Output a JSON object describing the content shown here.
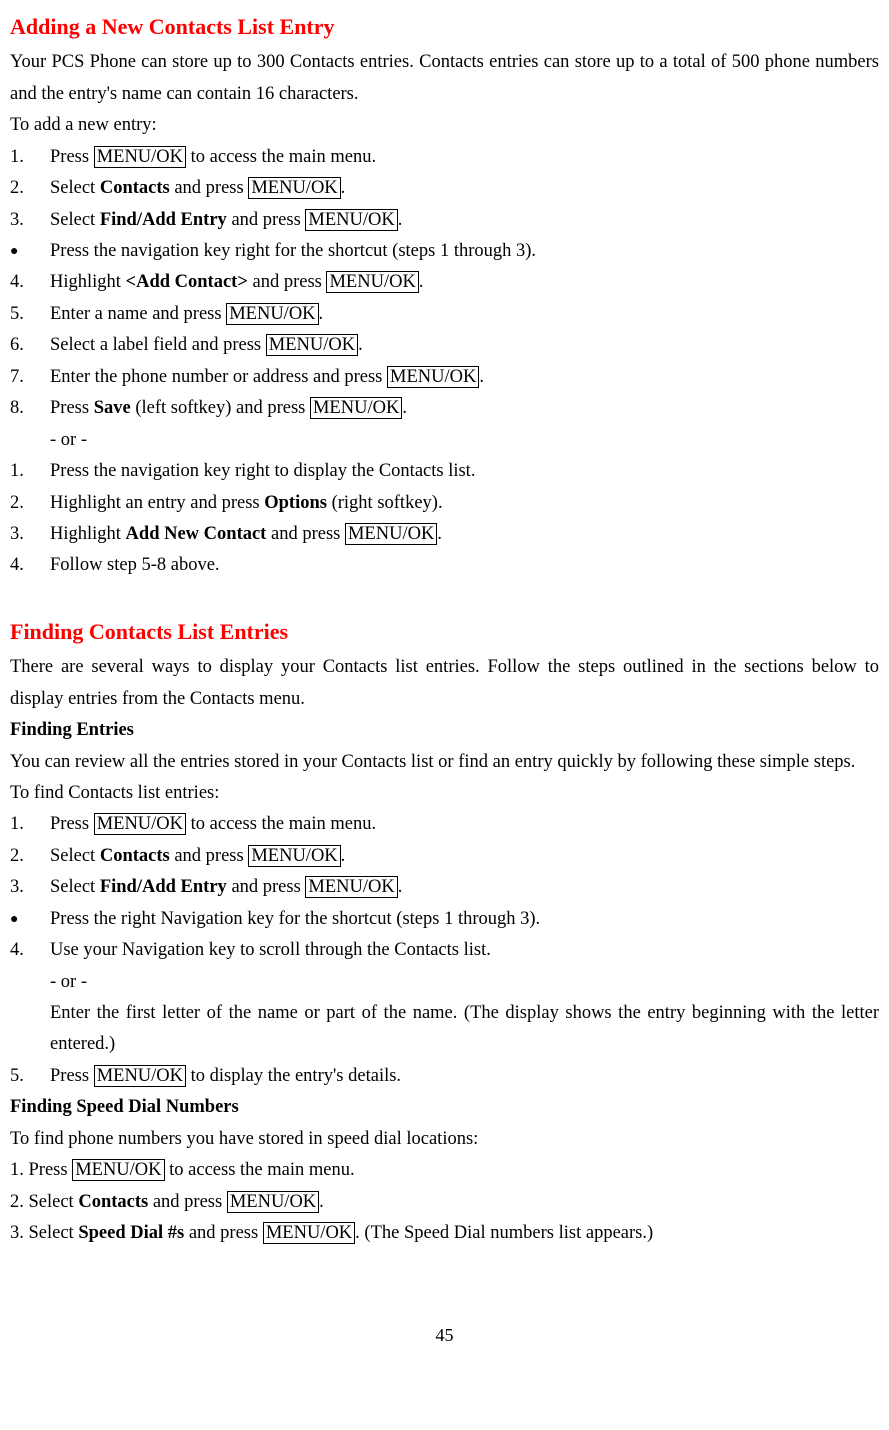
{
  "section1": {
    "heading": "Adding a New Contacts List Entry",
    "intro": "Your PCS Phone can store up to 300 Contacts entries. Contacts entries can store up to a total of 500 phone numbers and the entry's name can contain 16 characters.",
    "lead": "To add a new entry:",
    "steps_a": [
      {
        "n": "1.",
        "pre": "Press ",
        "box": "MENU/OK",
        "post": " to access the main menu."
      },
      {
        "n": "2.",
        "pre": "Select ",
        "bold": "Contacts",
        "mid": " and press ",
        "box": "MENU/OK",
        "post": "."
      },
      {
        "n": "3.",
        "pre": "Select ",
        "bold": "Find/Add Entry",
        "mid": " and press ",
        "box": "MENU/OK",
        "post": "."
      }
    ],
    "bullet_1": "Press the navigation key right for the shortcut (steps 1 through 3).",
    "steps_b": [
      {
        "n": "4.",
        "pre": "Highlight ",
        "bold": "<Add Contact>",
        "mid": " and press ",
        "box": "MENU/OK",
        "post": "."
      },
      {
        "n": "5.",
        "pre": "Enter a name and press ",
        "box": "MENU/OK",
        "post": "."
      },
      {
        "n": "6.",
        "pre": "Select a label field and press ",
        "box": "MENU/OK",
        "post": "."
      },
      {
        "n": "7.",
        "pre": "Enter the phone number or address and press ",
        "box": "MENU/OK",
        "post": "."
      },
      {
        "n": "8.",
        "pre": "Press ",
        "bold": "Save",
        "mid": " (left softkey) and press ",
        "box": "MENU/OK",
        "post": "."
      }
    ],
    "or": "- or -",
    "steps_c": [
      {
        "n": "1.",
        "text": "Press the navigation key right to display the Contacts list."
      },
      {
        "n": "2.",
        "pre": "Highlight an entry and press ",
        "bold": "Options",
        "post": " (right softkey)."
      },
      {
        "n": "3.",
        "pre": "Highlight ",
        "bold": "Add New Contact",
        "mid": " and press ",
        "box": "MENU/OK",
        "post": "."
      },
      {
        "n": "4.",
        "text": "Follow step 5-8 above."
      }
    ]
  },
  "section2": {
    "heading": "Finding Contacts List Entries",
    "intro": "There are several ways to display your Contacts list entries. Follow the steps outlined in the sections below to display entries from the Contacts menu.",
    "sub1_heading": "Finding Entries",
    "sub1_intro": "You can review all the entries stored in your Contacts list or find an entry quickly by following these simple steps.",
    "sub1_lead": "To find Contacts list entries:",
    "sub1_steps": [
      {
        "n": "1.",
        "pre": "Press ",
        "box": "MENU/OK",
        "post": " to access the main menu."
      },
      {
        "n": "2.",
        "pre": "Select ",
        "bold": "Contacts",
        "mid": " and press ",
        "box": "MENU/OK",
        "post": "."
      },
      {
        "n": "3.",
        "pre": "Select ",
        "bold": "Find/Add Entry",
        "mid": " and press ",
        "box": "MENU/OK",
        "post": "."
      }
    ],
    "sub1_bullet": "Press the right Navigation key for the shortcut (steps 1 through 3).",
    "sub1_step4": {
      "n": "4.",
      "text": "Use your Navigation key to scroll through the Contacts list."
    },
    "sub1_or": "- or -",
    "sub1_or_text": "Enter the first letter of the name or part of the name. (The display shows the entry beginning with the letter entered.)",
    "sub1_step5": {
      "n": "5.",
      "pre": "Press ",
      "box": "MENU/OK",
      "post": " to display the entry's details."
    },
    "sub2_heading": "Finding Speed Dial Numbers",
    "sub2_lead": "To find phone numbers you have stored in speed dial locations:",
    "sub2_steps": [
      {
        "n": "1. ",
        "pre": "Press ",
        "box": "MENU/OK",
        "post": " to access the main menu."
      },
      {
        "n": "2. ",
        "pre": "Select ",
        "bold": "Contacts",
        "mid": " and press ",
        "box": "MENU/OK",
        "post": "."
      },
      {
        "n": "3. ",
        "pre": "Select ",
        "bold": "Speed Dial #s",
        "mid": " and press ",
        "box": "MENU/OK",
        "post": ". (The Speed Dial numbers list appears.)"
      }
    ]
  },
  "page_number": "45"
}
